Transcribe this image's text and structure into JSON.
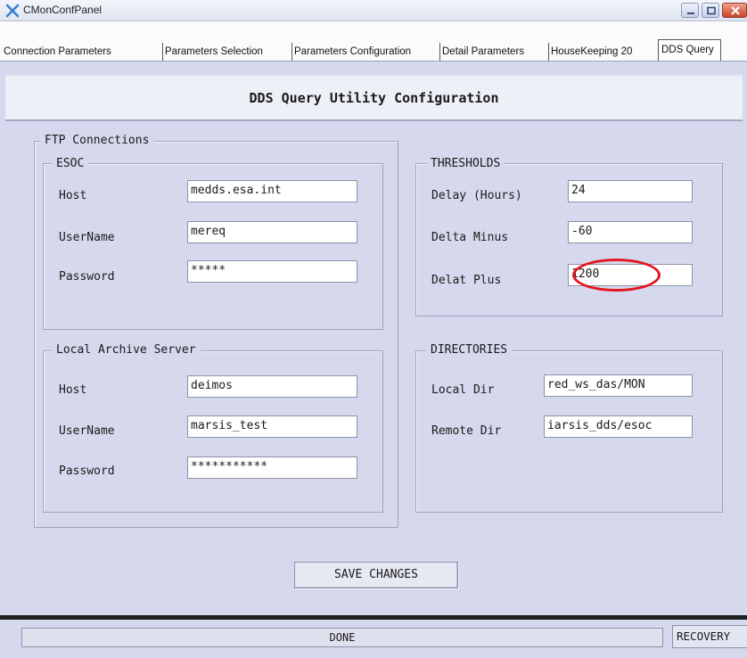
{
  "window": {
    "title": "CMonConfPanel"
  },
  "tabs": [
    "Connection Parameters",
    "Parameters Selection",
    "Parameters Configuration",
    "Detail Parameters",
    "HouseKeeping 20",
    "DDS Query"
  ],
  "header": "DDS Query Utility Configuration",
  "ftp": {
    "title": "FTP Connections",
    "esoc": {
      "title": "ESOC",
      "host_label": "Host",
      "host": "medds.esa.int",
      "user_label": "UserName",
      "user": "mereq",
      "pass_label": "Password",
      "pass": "*****"
    },
    "local": {
      "title": "Local Archive Server",
      "host_label": "Host",
      "host": "deimos",
      "user_label": "UserName",
      "user": "marsis_test",
      "pass_label": "Password",
      "pass": "***********"
    }
  },
  "thresholds": {
    "title": "THRESHOLDS",
    "delay_label": "Delay (Hours)",
    "delay": "24",
    "minus_label": "Delta Minus",
    "minus": "-60",
    "plus_label": "Delat Plus",
    "plus": "1200"
  },
  "directories": {
    "title": "DIRECTORIES",
    "local_label": "Local Dir",
    "local": "red_ws_das/MON",
    "remote_label": "Remote Dir",
    "remote": "iarsis_dds/esoc"
  },
  "save_label": "SAVE CHANGES",
  "status": "DONE",
  "recovery_label": "RECOVERY",
  "colors": {
    "highlight": "#e3161e",
    "panel": "#d6d9ee"
  },
  "icons": [
    "app-cross-icon",
    "minimize-icon",
    "maximize-icon",
    "close-icon"
  ]
}
